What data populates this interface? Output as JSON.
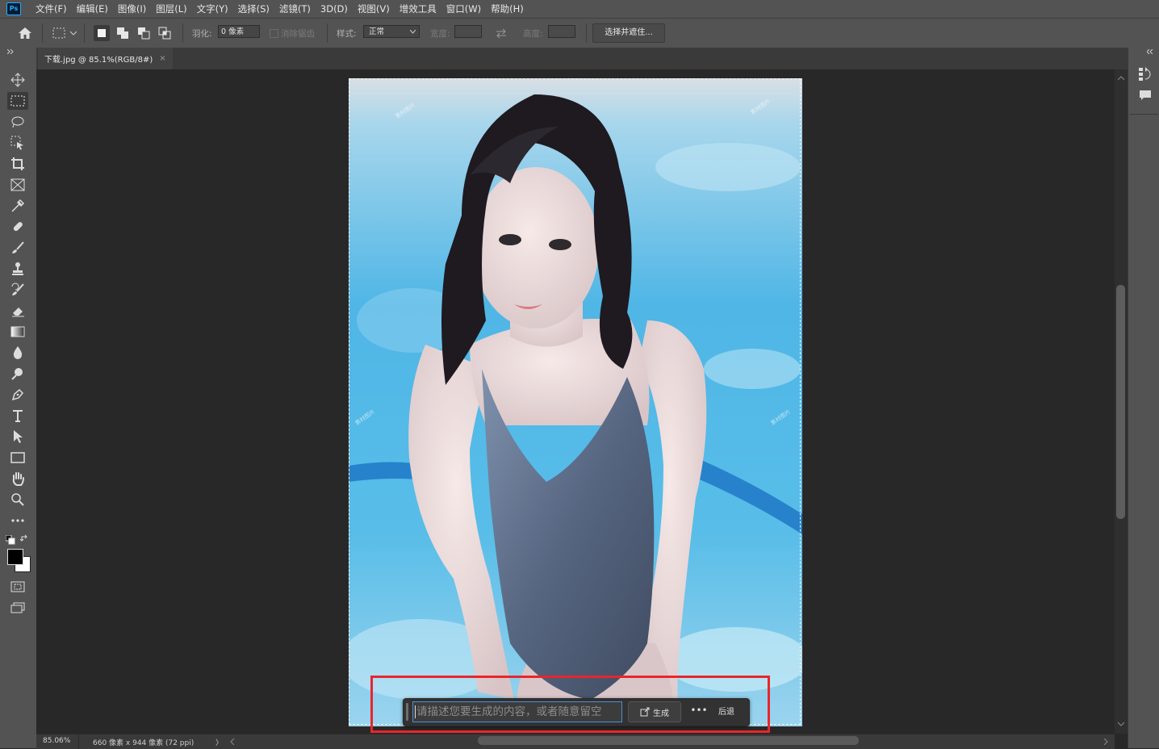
{
  "menubar": {
    "logo": "Ps",
    "items": [
      "文件(F)",
      "编辑(E)",
      "图像(I)",
      "图层(L)",
      "文字(Y)",
      "选择(S)",
      "滤镜(T)",
      "3D(D)",
      "视图(V)",
      "增效工具",
      "窗口(W)",
      "帮助(H)"
    ]
  },
  "options": {
    "feather_label": "羽化:",
    "feather_value": "0 像素",
    "antialias_label": "消除锯齿",
    "style_label": "样式:",
    "style_value": "正常",
    "width_label": "宽度:",
    "height_label": "高度:",
    "select_mask_label": "选择并遮住..."
  },
  "document": {
    "tab_title": "下载.jpg @ 85.1%(RGB/8#)",
    "close_glyph": "×"
  },
  "status": {
    "zoom": "85.06%",
    "size": "660 像素 x 944 像素 (72 ppi)",
    "arrow": "〉"
  },
  "taskbar": {
    "prompt_placeholder": "请描述您要生成的内容，或者随意留空",
    "generate_label": "生成",
    "more_glyph": "•••",
    "back_label": "后退"
  },
  "colors": {
    "accent_highlight": "#e8262c",
    "foreground_swatch": "#000000",
    "background_swatch": "#ffffff"
  }
}
